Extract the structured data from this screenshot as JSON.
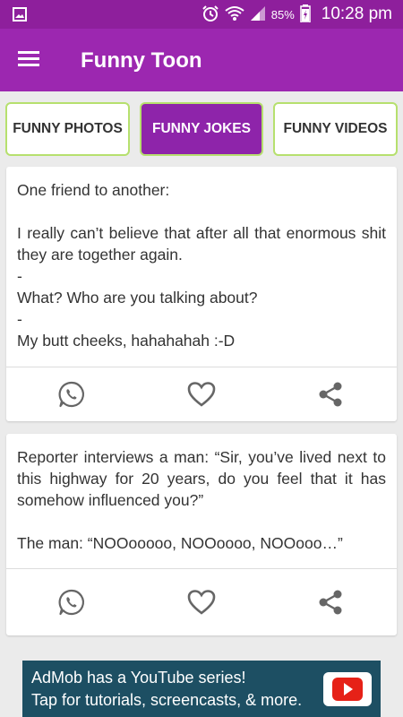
{
  "status_bar": {
    "battery": "85%",
    "time": "10:28 pm",
    "icons": [
      "image-icon",
      "alarm-icon",
      "wifi-icon",
      "signal-icon",
      "battery-charging-icon"
    ]
  },
  "app_bar": {
    "title": "Funny Toon",
    "menu_icon": "hamburger-menu-icon"
  },
  "tabs": [
    {
      "label": "FUNNY PHOTOS",
      "active": false
    },
    {
      "label": "FUNNY JOKES",
      "active": true
    },
    {
      "label": "FUNNY VIDEOS",
      "active": false
    }
  ],
  "jokes": [
    {
      "text": "One friend to another:\n\nI really can’t believe that after all that enormous shit they are together again.\n-\nWhat? Who are you talking about?\n-\nMy butt cheeks, hahahahah :-D",
      "actions": [
        "whatsapp-icon",
        "heart-icon",
        "share-icon"
      ]
    },
    {
      "text": "Reporter interviews a man: “Sir, you’ve lived next to this highway for 20 years, do you feel that it has somehow influenced you?”\n\nThe man: “NOOooooo, NOOoooo, NOOooo…”",
      "actions": [
        "whatsapp-icon",
        "heart-icon",
        "share-icon"
      ]
    }
  ],
  "ad": {
    "line1": "AdMob has a YouTube series!",
    "line2": "Tap for tutorials, screencasts, & more.",
    "icon": "youtube-play-icon"
  },
  "colors": {
    "status_bar": "#8e1f9c",
    "app_bar": "#9c27b0",
    "tab_active": "#8e24aa",
    "tab_border": "#b6e06e",
    "icon_gray": "#666666",
    "ad_bg": "#1d4f63"
  }
}
